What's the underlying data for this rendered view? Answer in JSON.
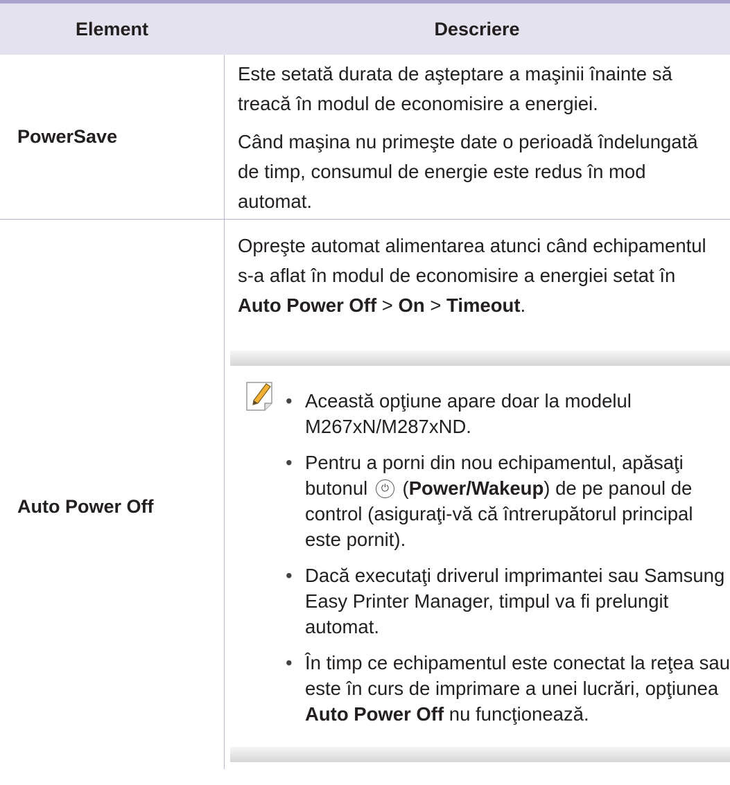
{
  "table": {
    "headers": {
      "element": "Element",
      "description": "Descriere"
    },
    "rows": [
      {
        "element": "PowerSave",
        "paragraphs": [
          "Este setată durata de aşteptare a maşinii înainte să treacă în modul de economisire a energiei.",
          "Când maşina nu primeşte date o perioadă îndelungată de timp, consumul de energie este redus în mod automat."
        ]
      },
      {
        "element": "Auto Power Off",
        "intro": {
          "text": "Opreşte automat alimentarea atunci când echipamentul s-a aflat în modul de economisire a energiei setat în ",
          "bold1": "Auto Power Off",
          "sep1": " > ",
          "bold2": "On",
          "sep2": " > ",
          "bold3": "Timeout",
          "end": "."
        },
        "note": {
          "icon": "note-pencil-icon",
          "bullets": {
            "b1": "Această opţiune apare doar la modelul M267xN/M287xND.",
            "b2_pre": "Pentru a porni din nou echipamentul, apăsaţi butonul ",
            "b2_icon": "power-icon",
            "b2_open": " (",
            "b2_bold": "Power/Wakeup",
            "b2_post": ") de pe panoul de control (asiguraţi-vă că întrerupătorul principal este pornit).",
            "b3": "Dacă executaţi driverul imprimantei sau Samsung Easy Printer Manager, timpul va fi prelungit automat.",
            "b4_pre": "În timp ce echipamentul este conectat la reţea sau este în curs de imprimare a unei lucrări, opţiunea ",
            "b4_bold": "Auto Power Off",
            "b4_post": " nu funcţionează."
          }
        }
      }
    ]
  },
  "colors": {
    "header_bg": "#e4e2ef",
    "rule": "#a9a4cc",
    "grid": "#b9b5d6",
    "text": "#231f20"
  }
}
